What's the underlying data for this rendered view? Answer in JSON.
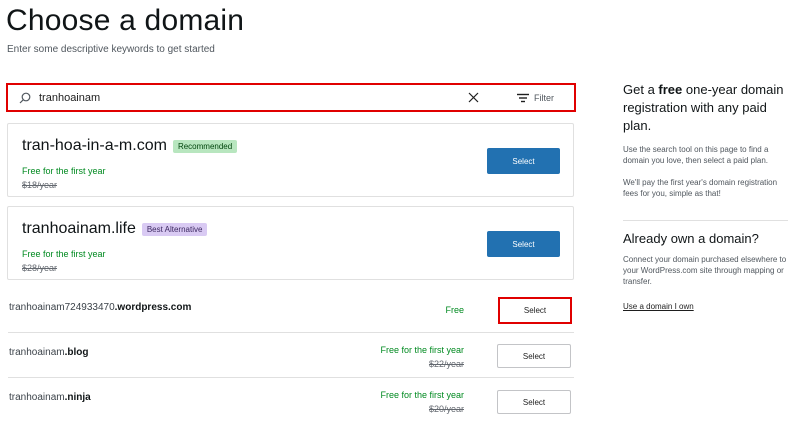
{
  "header": {
    "title": "Choose a domain",
    "subtitle": "Enter some descriptive keywords to get started"
  },
  "search": {
    "query": "tranhoainam",
    "filter_label": "Filter",
    "icon": "search-icon",
    "clear_icon": "close-icon",
    "filter_icon": "filter-icon"
  },
  "featured": [
    {
      "domain": "tran-hoa-in-a-m.com",
      "badge": "Recommended",
      "free_text": "Free for the first year",
      "original_price": "$18/year",
      "button": "Select"
    },
    {
      "domain": "tranhoainam.life",
      "badge": "Best Alternative",
      "free_text": "Free for the first year",
      "original_price": "$28/year",
      "button": "Select"
    }
  ],
  "results": [
    {
      "name_plain": "tranhoainam724933470",
      "name_bold": ".wordpress.com",
      "price": "Free",
      "original_price": "",
      "button": "Select"
    },
    {
      "name_plain": "tranhoainam",
      "name_bold": ".blog",
      "price": "Free for the first year",
      "original_price": "$22/year",
      "button": "Select"
    },
    {
      "name_plain": "tranhoainam",
      "name_bold": ".ninja",
      "price": "Free for the first year",
      "original_price": "$20/year",
      "button": "Select"
    }
  ],
  "sidebar": {
    "promo_pre": "Get a ",
    "promo_bold": "free",
    "promo_post": " one-year domain registration with any paid plan.",
    "promo_p1": "Use the search tool on this page to find a domain you love, then select a paid plan.",
    "promo_p2": "We'll pay the first year's domain registration fees for you, simple as that!",
    "own_title": "Already own a domain?",
    "own_text": "Connect your domain purchased elsewhere to your WordPress.com site through mapping or transfer.",
    "own_link": "Use a domain I own"
  },
  "colors": {
    "primary": "#2271b1",
    "green": "#008a20",
    "highlight": "#e00000"
  }
}
